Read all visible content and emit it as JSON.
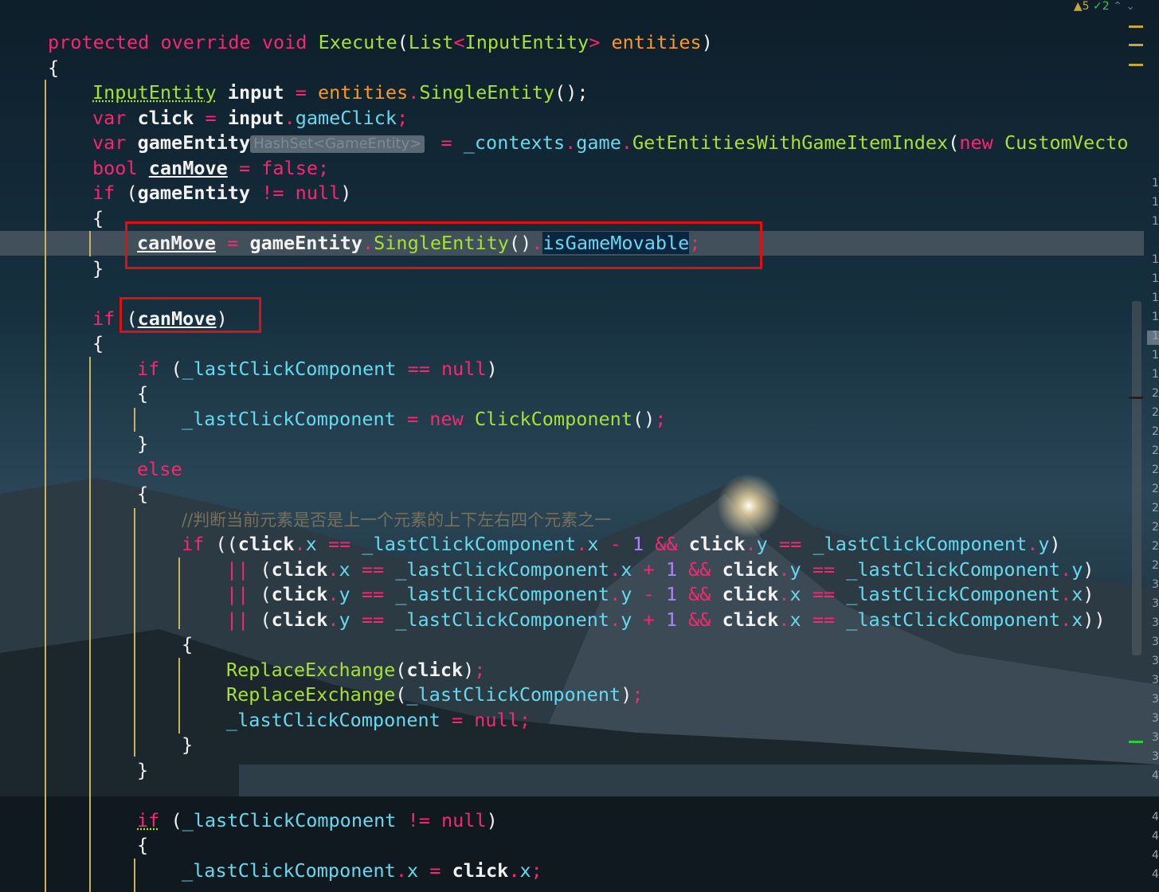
{
  "status": {
    "warnings": "▲5",
    "checks": "✓2",
    "arrows": "⌃ ⌄"
  },
  "gutter": [
    "1",
    "1",
    "1",
    "1",
    "1",
    "1",
    "1",
    "1",
    "1",
    "1",
    "2",
    "2",
    "2",
    "2",
    "2",
    "2",
    "2",
    "2",
    "2",
    "2",
    "3",
    "3",
    "3",
    "3",
    "3",
    "3",
    "3",
    "3",
    "3",
    "3",
    "4",
    "4",
    "4",
    "4",
    "4"
  ],
  "hint": {
    "type": "HashSet<GameEntity>"
  },
  "code": {
    "l1": {
      "protected": "protected",
      "override": "override",
      "void": "void",
      "name": "Execute",
      "lp": "(",
      "type": "List",
      "lt": "<",
      "gen": "InputEntity",
      "gt": ">",
      "param": "entities",
      "rp": ")"
    },
    "l2": {
      "brace": "{"
    },
    "l3": {
      "type": "InputEntity",
      "var": "input",
      "eq": " = ",
      "obj": "entities",
      "dot": ".",
      "call": "SingleEntity",
      "tail": "();"
    },
    "l4": {
      "kw": "var",
      "name": "click",
      "eq": " = ",
      "obj": "input",
      "dot": ".",
      "mem": "gameClick",
      "semi": ";"
    },
    "l5": {
      "kw": "var",
      "name": "gameEntity",
      "eq": " = ",
      "obj": "_contexts",
      "dot1": ".",
      "mem": "game",
      "dot2": ".",
      "call": "GetEntitiesWithGameItemIndex",
      "lp": "(",
      "new": "new",
      "type": "CustomVecto"
    },
    "l6": {
      "kw": "bool",
      "name": "canMove",
      "eq": " = ",
      "val": "false",
      "semi": ";"
    },
    "l7": {
      "kw": "if",
      "open": " (",
      "name": "gameEntity",
      "op": " != ",
      "val": "null",
      "close": ")"
    },
    "l8": {
      "brace": "{"
    },
    "l9": {
      "name": "canMove",
      "eq": " = ",
      "obj": "gameEntity",
      "dot": ".",
      "call": "SingleEntity",
      "paren": "()",
      "dot2": ".",
      "mem": "isGameMovable",
      "semi": ";"
    },
    "l10": {
      "brace": "}"
    },
    "l11": {
      "kw": "if",
      "open": " (",
      "name": "canMove",
      "close": ")"
    },
    "l12": {
      "brace": "{"
    },
    "l13": {
      "kw": "if",
      "open": " (",
      "name": "_lastClickComponent",
      "op": " == ",
      "val": "null",
      "close": ")"
    },
    "l14": {
      "brace": "{"
    },
    "l15": {
      "name": "_lastClickComponent",
      "eq": " = ",
      "new": "new",
      "type": "ClickComponent",
      "paren": "()",
      "semi": ";"
    },
    "l16": {
      "brace": "}"
    },
    "l17": {
      "kw": "else"
    },
    "l18": {
      "brace": "{"
    },
    "l19": {
      "comment": "//判断当前元素是否是上一个元素的上下左右四个元素之一"
    },
    "l20": {
      "kw": "if",
      "open": " ((",
      "a": "click",
      "d1": ".",
      "ax": "x",
      "op1": " == ",
      "b": "_lastClickComponent",
      "d2": ".",
      "bx": "x",
      "op2": " - ",
      "n": "1",
      "and": " && ",
      "c": "click",
      "d3": ".",
      "cy": "y",
      "op3": " == ",
      "e": "_lastClickComponent",
      "d4": ".",
      "ey": "y",
      "close": ")"
    },
    "l21": {
      "or": "|| ",
      "open": "(",
      "a": "click",
      "d1": ".",
      "ax": "x",
      "op1": " == ",
      "b": "_lastClickComponent",
      "d2": ".",
      "bx": "x",
      "op2": " + ",
      "n": "1",
      "and": " && ",
      "c": "click",
      "d3": ".",
      "cy": "y",
      "op3": " == ",
      "e": "_lastClickComponent",
      "d4": ".",
      "ey": "y",
      "close": ")"
    },
    "l22": {
      "or": "|| ",
      "open": "(",
      "a": "click",
      "d1": ".",
      "ax": "y",
      "op1": " == ",
      "b": "_lastClickComponent",
      "d2": ".",
      "bx": "y",
      "op2": " - ",
      "n": "1",
      "and": " && ",
      "c": "click",
      "d3": ".",
      "cy": "x",
      "op3": " == ",
      "e": "_lastClickComponent",
      "d4": ".",
      "ey": "x",
      "close": ")"
    },
    "l23": {
      "or": "|| ",
      "open": "(",
      "a": "click",
      "d1": ".",
      "ax": "y",
      "op1": " == ",
      "b": "_lastClickComponent",
      "d2": ".",
      "bx": "y",
      "op2": " + ",
      "n": "1",
      "and": " && ",
      "c": "click",
      "d3": ".",
      "cy": "x",
      "op3": " == ",
      "e": "_lastClickComponent",
      "d4": ".",
      "ey": "x",
      "close": "))"
    },
    "l24": {
      "brace": "{"
    },
    "l25": {
      "call": "ReplaceExchange",
      "open": "(",
      "arg": "click",
      "close": ")",
      "semi": ";"
    },
    "l26": {
      "call": "ReplaceExchange",
      "open": "(",
      "arg": "_lastClickComponent",
      "close": ")",
      "semi": ";"
    },
    "l27": {
      "name": "_lastClickComponent",
      "eq": " = ",
      "val": "null",
      "semi": ";"
    },
    "l28": {
      "brace": "}"
    },
    "l29": {
      "brace": "}"
    },
    "l30": {
      "kw": "if",
      "open": " (",
      "name": "_lastClickComponent",
      "op": " != ",
      "val": "null",
      "close": ")"
    },
    "l31": {
      "brace": "{"
    },
    "l32": {
      "name": "_lastClickComponent",
      "d1": ".",
      "mem": "x",
      "eq": " = ",
      "obj": "click",
      "d2": ".",
      "mem2": "x",
      "semi": ";"
    }
  }
}
